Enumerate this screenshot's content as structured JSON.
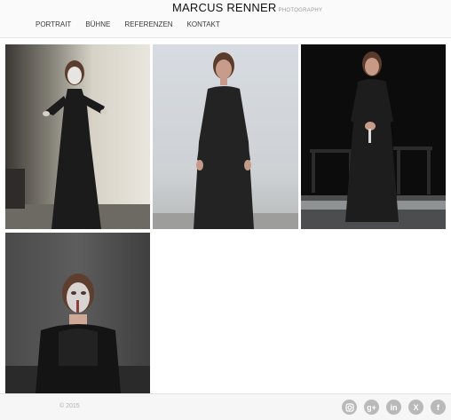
{
  "brand": {
    "name": "MARCUS RENNER",
    "tagline": "PHOTOGRAPHY"
  },
  "nav": [
    {
      "label": "PORTRAIT"
    },
    {
      "label": "BÜHNE"
    },
    {
      "label": "REFERENZEN"
    },
    {
      "label": "KONTAKT"
    }
  ],
  "gallery": [
    {
      "subject": "actress in black dress, white face makeup, arm outstretched"
    },
    {
      "subject": "actress in black dress, standing on stage"
    },
    {
      "subject": "actress in black dress holding a knife, dark stage"
    },
    {
      "subject": "close-up of actress with painted face, black lace dress"
    }
  ],
  "footer": {
    "copyright": "© 2015",
    "socials": [
      {
        "icon": "instagram-icon"
      },
      {
        "icon": "google-plus-icon",
        "glyph": "g+"
      },
      {
        "icon": "linkedin-icon",
        "glyph": "in"
      },
      {
        "icon": "xing-icon",
        "glyph": "X"
      },
      {
        "icon": "facebook-icon",
        "glyph": "f"
      }
    ]
  },
  "colors": {
    "header_bg": "#fafafa",
    "footer_bg": "#f6f6f6",
    "icon_gray": "#b9b9b9"
  }
}
